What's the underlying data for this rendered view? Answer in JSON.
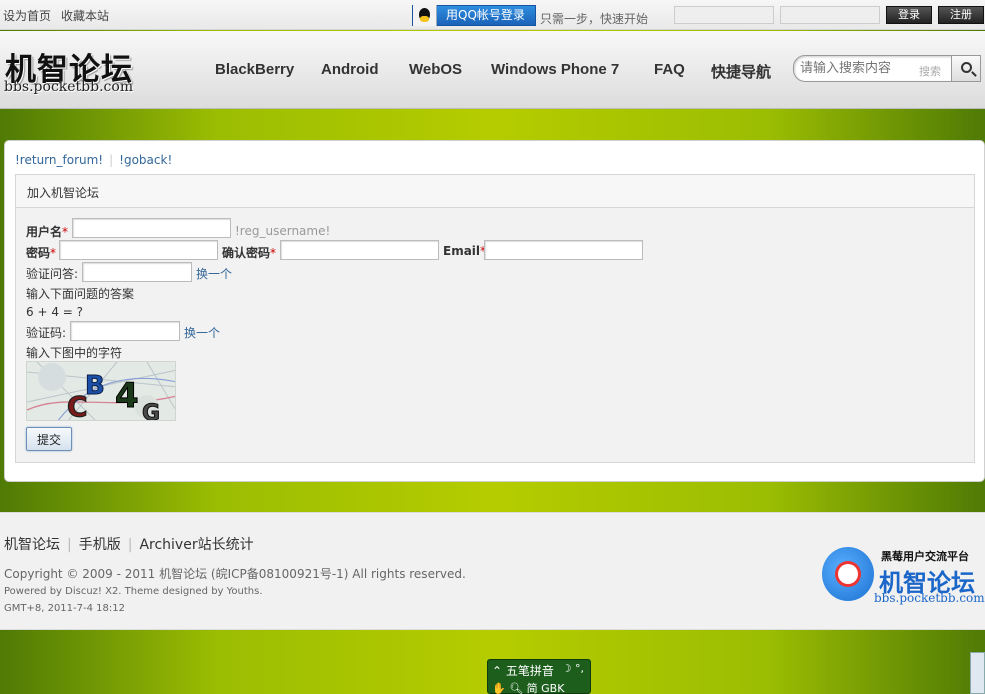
{
  "topbar": {
    "set_home": "设为首页",
    "bookmark": "收藏本站",
    "qq_login": "用QQ帐号登录",
    "qq_tip": "只需一步，快速开始",
    "login": "登录",
    "register": "注册"
  },
  "header": {
    "logo_name": "机智论坛",
    "logo_url": "bbs.pocketbb.com",
    "nav": [
      "BlackBerry",
      "Android",
      "WebOS",
      "Windows Phone 7",
      "FAQ",
      "快捷导航"
    ],
    "search_placeholder": "请输入搜索内容",
    "search_scope": "搜索"
  },
  "breadcrumb": {
    "return_forum": "!return_forum!",
    "goback": "!goback!"
  },
  "form": {
    "title": "加入机智论坛",
    "username_label": "用户名",
    "username_hint": "!reg_username!",
    "password_label": "密码",
    "confirm_password_label": "确认密码",
    "email_label": "Email",
    "required_mark": "*",
    "question_label": "验证问答:",
    "question_change": "换一个",
    "question_hint": "输入下面问题的答案",
    "question": "6 + 4 = ?",
    "captcha_label": "验证码:",
    "captcha_change": "换一个",
    "captcha_hint": "输入下图中的字符",
    "captcha_text": "CB4G",
    "submit": "提交"
  },
  "footer": {
    "links": [
      "机智论坛",
      "手机版",
      "Archiver站长统计"
    ],
    "copyright": "Copyright © 2009 - 2011 机智论坛 (皖ICP备08100921号-1) All rights reserved.",
    "powered": "Powered by Discuz! X2. Theme designed by Youths.",
    "gmt": "GMT+8, 2011-7-4 18:12",
    "logo_tagline": "黑莓用户交流平台",
    "logo_name": "机智论坛",
    "logo_url": "bbs.pocketbb.com"
  },
  "ime": {
    "mode": "五笔拼音",
    "state": "简 GBK"
  },
  "colors": {
    "link": "#336699",
    "qq_button": "#1f73c9",
    "page_green": "#9bbd02",
    "required": "#cc0000"
  }
}
